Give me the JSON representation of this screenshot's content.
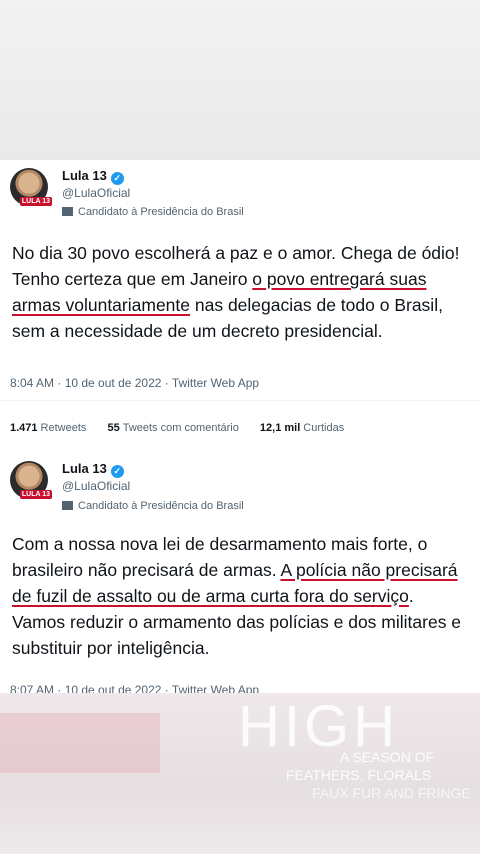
{
  "tweets": [
    {
      "display_name": "Lula 13",
      "handle": "@LulaOficial",
      "label": "Candidato à Presidência do Brasil",
      "avatar_badge": "LULA 13",
      "text_parts": [
        {
          "text": "No dia 30 povo escolherá a paz e o amor. Chega de ódio! Tenho certeza que em Janeiro ",
          "underline": false
        },
        {
          "text": "o povo entregará suas armas voluntariamente",
          "underline": true
        },
        {
          "text": " nas delegacias de todo o Brasil, sem a necessidade de um decreto presidencial.",
          "underline": false
        }
      ],
      "timestamp": "8:04 AM · 10 de out de 2022 · Twitter Web App",
      "stats": {
        "retweets_count": "1.471",
        "retweets_label": "Retweets",
        "quotes_count": "55",
        "quotes_label": "Tweets com comentário",
        "likes_count": "12,1 mil",
        "likes_label": "Curtidas"
      }
    },
    {
      "display_name": "Lula 13",
      "handle": "@LulaOficial",
      "label": "Candidato à Presidência do Brasil",
      "avatar_badge": "LULA 13",
      "text_parts": [
        {
          "text": "Com a nossa nova lei de desarmamento mais forte, o brasileiro não precisará de armas. ",
          "underline": false
        },
        {
          "text": "A polícia não precisará de fuzil de assalto ou de arma curta fora do serviço",
          "underline": true
        },
        {
          "text": ". Vamos reduzir o armamento das polícias e dos militares e substituir por inteligência.",
          "underline": false
        }
      ],
      "timestamp": "8:07 AM · 10 de out de 2022 · Twitter Web App"
    }
  ],
  "watermark": {
    "title": "HIGH",
    "line1": "A SEASON OF",
    "line2": "FEATHERS, FLORALS",
    "line3": "FAUX FUR AND FRINGE"
  },
  "colors": {
    "accent": "#c8102e",
    "verified": "#1d9bf0",
    "secondary_text": "#536471"
  },
  "icons": [
    "verified-badge-icon",
    "candidate-label-icon"
  ]
}
